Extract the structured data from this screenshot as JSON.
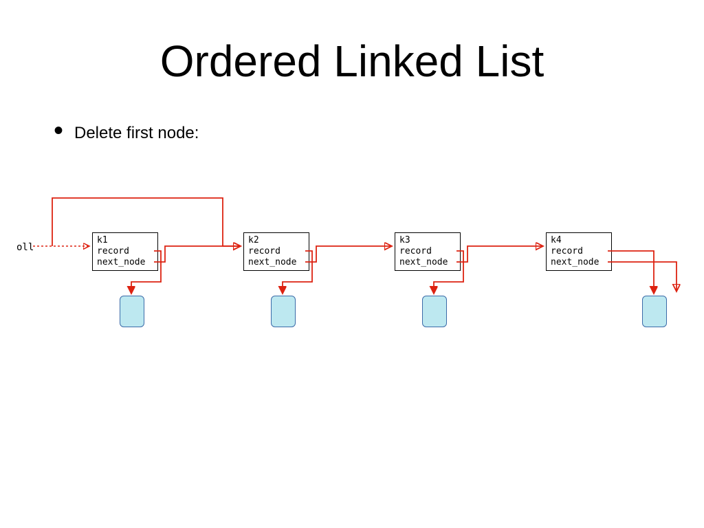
{
  "title": "Ordered Linked List",
  "bullet": "Delete first node:",
  "oll_label": "oll",
  "nodes": [
    {
      "k": "k1",
      "r": "record",
      "n": "next_node"
    },
    {
      "k": "k2",
      "r": "record",
      "n": "next_node"
    },
    {
      "k": "k3",
      "r": "record",
      "n": "next_node"
    },
    {
      "k": "k4",
      "r": "record",
      "n": "next_node"
    }
  ]
}
